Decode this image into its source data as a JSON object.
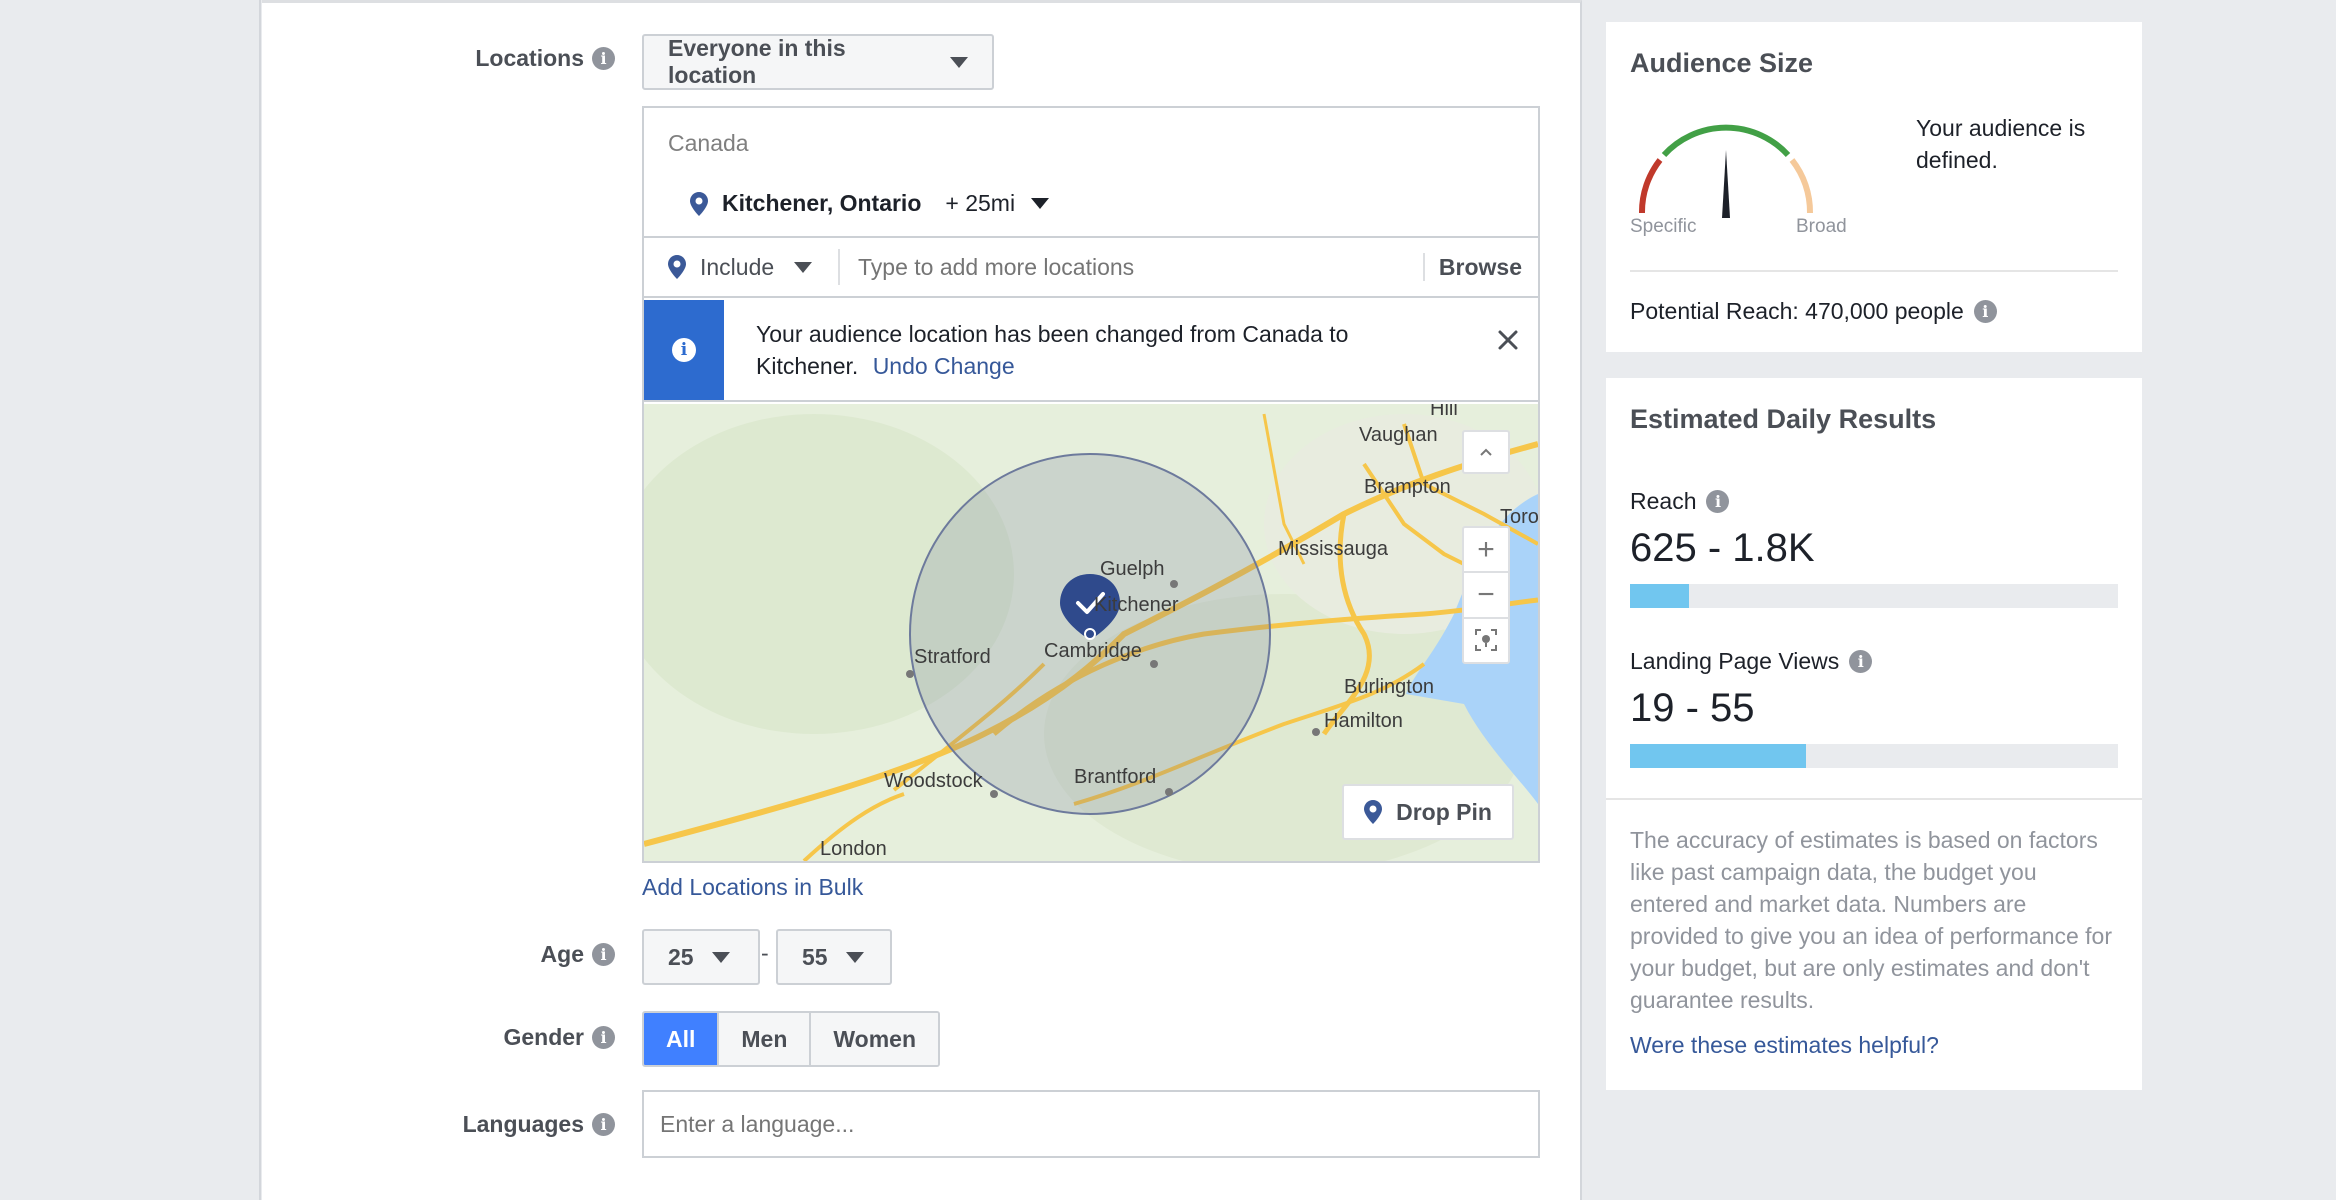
{
  "locations": {
    "label": "Locations",
    "dropdown_label": "Everyone in this location",
    "country": "Canada",
    "selected_location": "Kitchener, Ontario",
    "radius": "+ 25mi",
    "include_label": "Include",
    "search_placeholder": "Type to add more locations",
    "browse_label": "Browse",
    "notice_text": "Your audience location has been changed from Canada to Kitchener.",
    "undo_label": "Undo Change",
    "bulk_link": "Add Locations in Bulk",
    "drop_pin_label": "Drop Pin",
    "zoom_in": "+",
    "zoom_out": "−",
    "map_places": [
      "Hill",
      "Vaughan",
      "Brampton",
      "Toro",
      "Mississauga",
      "Guelph",
      "Kitchener",
      "Stratford",
      "Cambridge",
      "Burlington",
      "Hamilton",
      "Woodstock",
      "Brantford",
      "London"
    ]
  },
  "age": {
    "label": "Age",
    "min": "25",
    "separator": "-",
    "max": "55"
  },
  "gender": {
    "label": "Gender",
    "options": [
      "All",
      "Men",
      "Women"
    ],
    "selected": "All"
  },
  "languages": {
    "label": "Languages",
    "placeholder": "Enter a language..."
  },
  "audience_size": {
    "title": "Audience Size",
    "status": "Your audience is defined.",
    "specific_label": "Specific",
    "broad_label": "Broad",
    "potential_reach": "Potential Reach: 470,000 people"
  },
  "daily_results": {
    "title": "Estimated Daily Results",
    "reach_label": "Reach",
    "reach_value": "625 - 1.8K",
    "reach_fill": 0.12,
    "lpv_label": "Landing Page Views",
    "lpv_value": "19 - 55",
    "lpv_fill": 0.36,
    "disclaimer": "The accuracy of estimates is based on factors like past campaign data, the budget you entered and market data. Numbers are provided to give you an idea of performance for your budget, but are only estimates and don't guarantee results.",
    "feedback_link": "Were these estimates helpful?"
  },
  "colors": {
    "accent": "#4080ff",
    "link": "#365899",
    "notice": "#2d6bcf",
    "bar": "#71c6ef"
  }
}
